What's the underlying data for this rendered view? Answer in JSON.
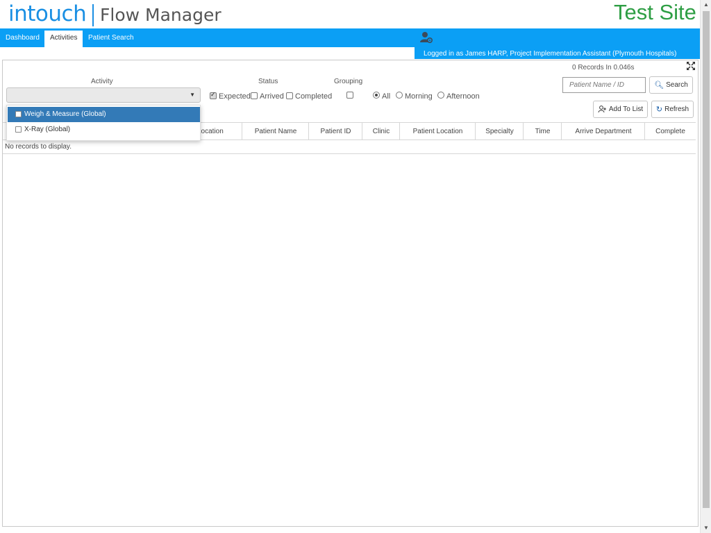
{
  "header": {
    "logo_intouch": "intouch",
    "logo_product": "Flow Manager",
    "site_label": "Test Site",
    "site_color": "#2e9e44",
    "brand_color": "#1a8fe3"
  },
  "nav": {
    "tabs": [
      {
        "label": "Dashboard",
        "active": false
      },
      {
        "label": "Activities",
        "active": true
      },
      {
        "label": "Patient Search",
        "active": false
      }
    ],
    "bar_color": "#0b9ff5",
    "user_icon": "user-settings-icon",
    "logged_in_text": "Logged in as James HARP, Project Implementation Assistant (Plymouth Hospitals)"
  },
  "filters": {
    "activity_label": "Activity",
    "activity_value": "",
    "activity_options": [
      {
        "label": "Weigh & Measure (Global)",
        "checked": false,
        "highlighted": true
      },
      {
        "label": "X-Ray (Global)",
        "checked": false,
        "highlighted": false
      }
    ],
    "status_label": "Status",
    "status_options": [
      {
        "label": "Expected",
        "checked": true
      },
      {
        "label": "Arrived",
        "checked": false
      },
      {
        "label": "Completed",
        "checked": false
      }
    ],
    "grouping_label": "Grouping",
    "grouping_checked": false,
    "time_options": [
      {
        "label": "All",
        "selected": true
      },
      {
        "label": "Morning",
        "selected": false
      },
      {
        "label": "Afternoon",
        "selected": false
      }
    ]
  },
  "toolbar": {
    "records_text": "0 Records In 0.046s",
    "expand_icon": "fullscreen-icon",
    "search_placeholder": "Patient Name / ID",
    "search_label": "Search",
    "search_icon": "search-icon",
    "add_label": "Add To List",
    "add_icon": "add-user-icon",
    "refresh_label": "Refresh",
    "refresh_icon": "refresh-icon"
  },
  "table": {
    "columns": [
      "Location",
      "Patient Name",
      "Patient ID",
      "Clinic",
      "Patient Location",
      "Specialty",
      "Time",
      "Arrive Department",
      "Complete"
    ],
    "empty_text": "No records to display."
  }
}
